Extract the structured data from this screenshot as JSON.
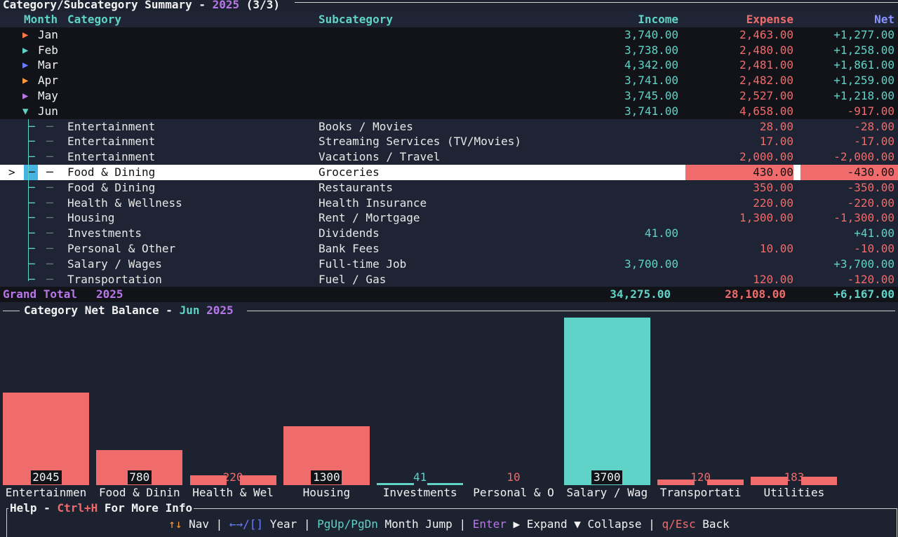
{
  "title": {
    "main": "Category/Subcategory Summary - ",
    "year": "2025",
    "page": " (3/3)"
  },
  "table": {
    "headers": {
      "month": "Month",
      "category": "Category",
      "subcategory": "Subcategory",
      "income": "Income",
      "expense": "Expense",
      "net": "Net"
    },
    "months": [
      {
        "arrow": "▶",
        "arrow_color": "#ff7a4a",
        "name": "Jan",
        "income": "3,740.00",
        "expense": "2,463.00",
        "net": "+1,277.00"
      },
      {
        "arrow": "▶",
        "arrow_color": "#5fd3c7",
        "name": "Feb",
        "income": "3,738.00",
        "expense": "2,480.00",
        "net": "+1,258.00"
      },
      {
        "arrow": "▶",
        "arrow_color": "#6a7cff",
        "name": "Mar",
        "income": "4,342.00",
        "expense": "2,481.00",
        "net": "+1,861.00"
      },
      {
        "arrow": "▶",
        "arrow_color": "#ff9a3a",
        "name": "Apr",
        "income": "3,741.00",
        "expense": "2,482.00",
        "net": "+1,259.00"
      },
      {
        "arrow": "▶",
        "arrow_color": "#b877e8",
        "name": "May",
        "income": "3,745.00",
        "expense": "2,527.00",
        "net": "+1,218.00"
      },
      {
        "arrow": "▼",
        "arrow_color": "#5fd3c7",
        "name": "Jun",
        "income": "3,741.00",
        "expense": "4,658.00",
        "net": "-917.00"
      }
    ],
    "subrows": [
      {
        "category": "Entertainment",
        "subcategory": "Books / Movies",
        "income": "",
        "expense": "28.00",
        "net": "-28.00"
      },
      {
        "category": "Entertainment",
        "subcategory": "Streaming Services (TV/Movies)",
        "income": "",
        "expense": "17.00",
        "net": "-17.00"
      },
      {
        "category": "Entertainment",
        "subcategory": "Vacations / Travel",
        "income": "",
        "expense": "2,000.00",
        "net": "-2,000.00"
      },
      {
        "category": "Food & Dining",
        "subcategory": "Groceries",
        "income": "",
        "expense": "430.00",
        "net": "-430.00",
        "selected": true
      },
      {
        "category": "Food & Dining",
        "subcategory": "Restaurants",
        "income": "",
        "expense": "350.00",
        "net": "-350.00"
      },
      {
        "category": "Health & Wellness",
        "subcategory": "Health Insurance",
        "income": "",
        "expense": "220.00",
        "net": "-220.00"
      },
      {
        "category": "Housing",
        "subcategory": "Rent / Mortgage",
        "income": "",
        "expense": "1,300.00",
        "net": "-1,300.00"
      },
      {
        "category": "Investments",
        "subcategory": "Dividends",
        "income": "41.00",
        "expense": "",
        "net": "+41.00"
      },
      {
        "category": "Personal & Other",
        "subcategory": "Bank Fees",
        "income": "",
        "expense": "10.00",
        "net": "-10.00"
      },
      {
        "category": "Salary / Wages",
        "subcategory": "Full-time Job",
        "income": "3,700.00",
        "expense": "",
        "net": "+3,700.00"
      },
      {
        "category": "Transportation",
        "subcategory": "Fuel / Gas",
        "income": "",
        "expense": "120.00",
        "net": "-120.00"
      }
    ],
    "selected_marker": ">",
    "grand_total": {
      "label": "Grand Total",
      "year": "2025",
      "income": "34,275.00",
      "expense": "28,108.00",
      "net": "+6,167.00"
    }
  },
  "chart_title": {
    "label": "Category Net Balance - ",
    "month": "Jun",
    "year": " 2025"
  },
  "chart_data": {
    "type": "bar",
    "categories": [
      "Entertainmen",
      "Food & Dinin",
      "Health & Wel",
      "Housing",
      "Investments",
      "Personal & O",
      "Salary / Wag",
      "Transportati",
      "Utilities"
    ],
    "values": [
      -2045,
      -780,
      -220,
      -1300,
      41,
      -10,
      3700,
      -120,
      -183
    ],
    "value_labels": [
      "2045",
      "780",
      "220",
      "1300",
      "41",
      "10",
      "3700",
      "120",
      "183"
    ],
    "colors": {
      "negative": "#f06b6b",
      "positive": "#5fd3c7"
    }
  },
  "help": {
    "title_prefix": "Help - ",
    "title_key": "Ctrl+H",
    "title_suffix": " For More Info",
    "items": [
      {
        "key": "↑↓",
        "key_color": "#ff9a3a",
        "text": " Nav"
      },
      {
        "key": "←→/[]",
        "key_color": "#6a7cff",
        "text": " Year"
      },
      {
        "key": "PgUp/PgDn",
        "key_color": "#5fd3c7",
        "text": " Month Jump"
      },
      {
        "key": "Enter",
        "key_color": "#b877e8",
        "text": " ▶ Expand ▼ Collapse"
      },
      {
        "key": "q/Esc",
        "key_color": "#f06b6b",
        "text": " Back"
      }
    ],
    "separator": " | "
  }
}
